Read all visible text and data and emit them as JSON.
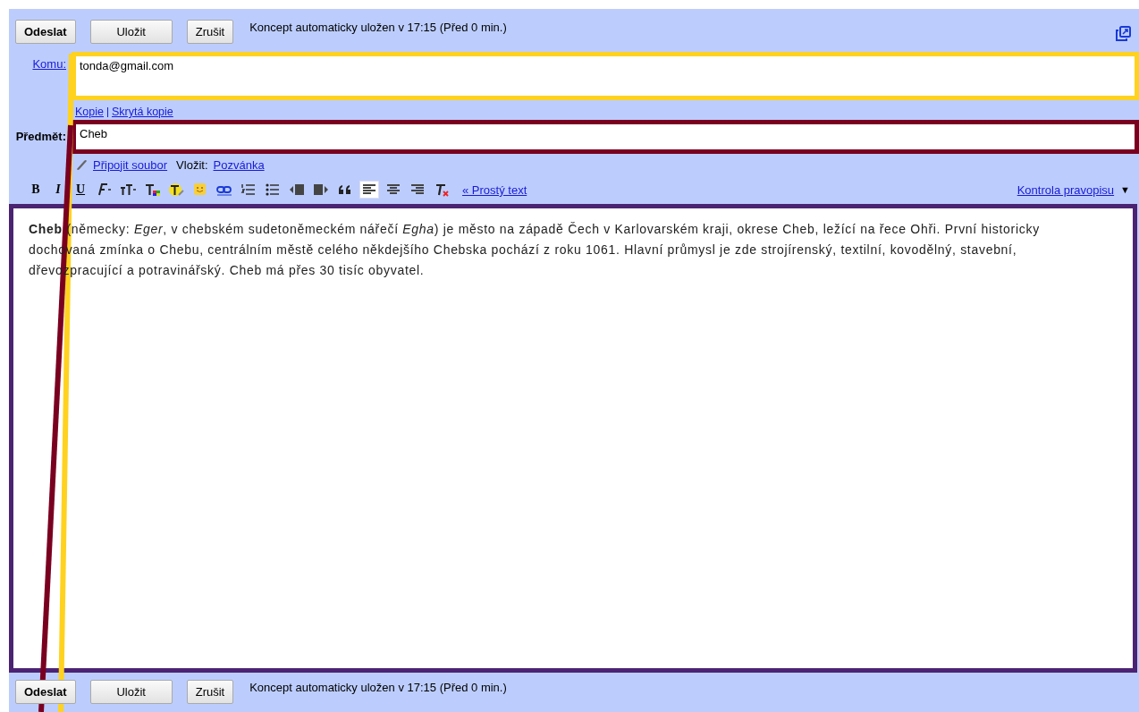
{
  "top_actions": {
    "buttons": [
      "Odeslat",
      "Uložit",
      "Zrušit"
    ],
    "status": "Koncept automaticky uložen v 17:15 (Před 0 min.)"
  },
  "to": {
    "label": "Komu:",
    "value": "tonda@gmail.com"
  },
  "cc_links": [
    "Kopie",
    "Skrytá kopie"
  ],
  "subject": {
    "label": "Předmět:",
    "value": "Cheb"
  },
  "attach": {
    "link": "Připojit soubor",
    "insert_label": "Vložit:",
    "insert_link": "Pozvánka"
  },
  "toolbar": [
    {
      "kind": "text",
      "label": "B",
      "selected": false
    },
    {
      "kind": "text",
      "label": "I",
      "selected": false
    },
    {
      "kind": "text",
      "label": "U",
      "selected": false
    },
    {
      "kind": "font",
      "selected": false
    },
    {
      "kind": "size",
      "selected": false
    },
    {
      "kind": "color",
      "selected": false
    },
    {
      "kind": "highlight",
      "selected": false
    },
    {
      "kind": "emoji",
      "selected": false
    },
    {
      "kind": "link",
      "selected": false
    },
    {
      "kind": "numbered",
      "selected": false
    },
    {
      "kind": "bulleted",
      "selected": false
    },
    {
      "kind": "outdent",
      "selected": false
    },
    {
      "kind": "indent",
      "selected": false
    },
    {
      "kind": "quote",
      "selected": false
    },
    {
      "kind": "align-left",
      "selected": true
    },
    {
      "kind": "align-center",
      "selected": false
    },
    {
      "kind": "align-right",
      "selected": false
    },
    {
      "kind": "clear",
      "selected": false
    }
  ],
  "plain_text_link": "« Prostý text",
  "spellcheck": {
    "label": "Kontrola pravopisu",
    "caret": "▼"
  },
  "body": "**Cheb** (německy: *Eger*, v chebském sudetoněmeckém nářečí *Egha*) je město na západě Čech v Karlovarském kraji, okrese Cheb, ležící na řece Ohři. První historicky dochovaná zmínka o Chebu, centrálním městě celého někdejšího Chebska pochází z roku 1061. Hlavní průmysl je zde strojírenský, textilní, kovodělný, stavební, dřevozpracující a potravinářský. Cheb má přes 30 tisíc obyvatel.",
  "bottom_actions": {
    "buttons": [
      "Odeslat",
      "Uložit",
      "Zrušit"
    ],
    "status": "Koncept automaticky uložen v 17:15 (Před 0 min.)"
  }
}
